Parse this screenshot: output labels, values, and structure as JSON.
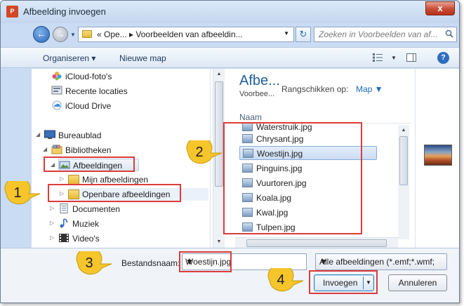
{
  "window": {
    "title": "Afbeelding invoegen",
    "app_icon_text": "P",
    "close_label": "x"
  },
  "address": {
    "path": "« Ope...  ▸ Voorbeelden van afbeeldin...",
    "search_placeholder": "Zoeken in Voorbeelden van af..."
  },
  "toolbar": {
    "organize": "Organiseren ▾",
    "new_folder": "Nieuwe map"
  },
  "nav": {
    "items": [
      {
        "label": "iCloud-foto's"
      },
      {
        "label": "Recente locaties"
      },
      {
        "label": "iCloud Drive"
      },
      {
        "label": "Bureaublad"
      },
      {
        "label": "Bibliotheken"
      },
      {
        "label": "Afbeeldingen"
      },
      {
        "label": "Mijn afbeeldingen"
      },
      {
        "label": "Openbare afbeeldingen"
      },
      {
        "label": "Documenten"
      },
      {
        "label": "Muziek"
      },
      {
        "label": "Video's"
      }
    ]
  },
  "files": {
    "library_title": "Afbe...",
    "library_sub": "Voorbee...",
    "arrange_label": "Rangschikken op:",
    "arrange_value": "Map",
    "column_header": "Naam",
    "items": [
      {
        "name": "Waterstruik.jpg"
      },
      {
        "name": "Chrysant.jpg"
      },
      {
        "name": "Woestijn.jpg"
      },
      {
        "name": "Pinguins.jpg"
      },
      {
        "name": "Vuurtoren.jpg"
      },
      {
        "name": "Koala.jpg"
      },
      {
        "name": "Kwal.jpg"
      },
      {
        "name": "Tulpen.jpg"
      }
    ],
    "selected_index": 2
  },
  "bottom": {
    "filename_label": "Bestandsnaam:",
    "filename_value": "Woestijn.jpg",
    "filter_value": "Alle afbeeldingen (*.emf;*.wmf;",
    "insert_label": "Invoegen",
    "cancel_label": "Annuleren"
  },
  "callouts": [
    "1",
    "2",
    "3",
    "4"
  ],
  "colors": {
    "highlight_box": "#dc3c3c",
    "callout_fill": "#f5c52a",
    "accent_blue": "#1e6bbd"
  }
}
